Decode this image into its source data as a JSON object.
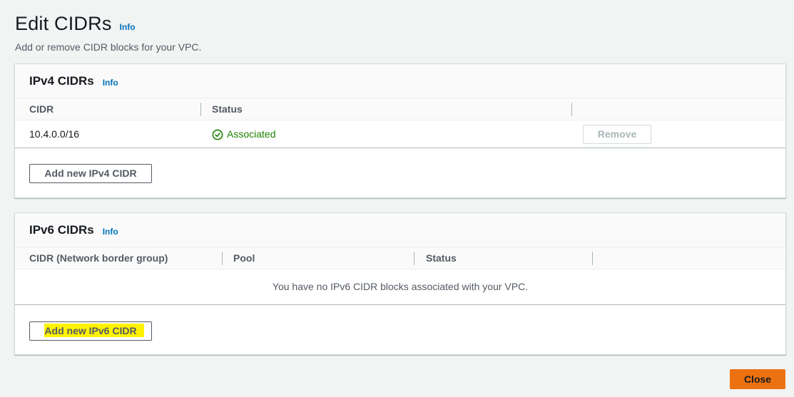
{
  "header": {
    "title": "Edit CIDRs",
    "info": "Info",
    "description": "Add or remove CIDR blocks for your VPC."
  },
  "ipv4": {
    "title": "IPv4 CIDRs",
    "info": "Info",
    "columns": [
      "CIDR",
      "Status"
    ],
    "rows": [
      {
        "cidr": "10.4.0.0/16",
        "status": "Associated",
        "remove_label": "Remove"
      }
    ],
    "add_label": "Add new IPv4 CIDR"
  },
  "ipv6": {
    "title": "IPv6 CIDRs",
    "info": "Info",
    "columns": [
      "CIDR (Network border group)",
      "Pool",
      "Status"
    ],
    "empty_message": "You have no IPv6 CIDR blocks associated with your VPC.",
    "add_label": "Add new IPv6 CIDR"
  },
  "footer": {
    "close_label": "Close"
  },
  "colors": {
    "accent": "#ec7211",
    "link": "#0073bb",
    "success": "#1d8102",
    "highlight": "#fff200"
  },
  "icons": {
    "status": "check-circle-icon"
  }
}
